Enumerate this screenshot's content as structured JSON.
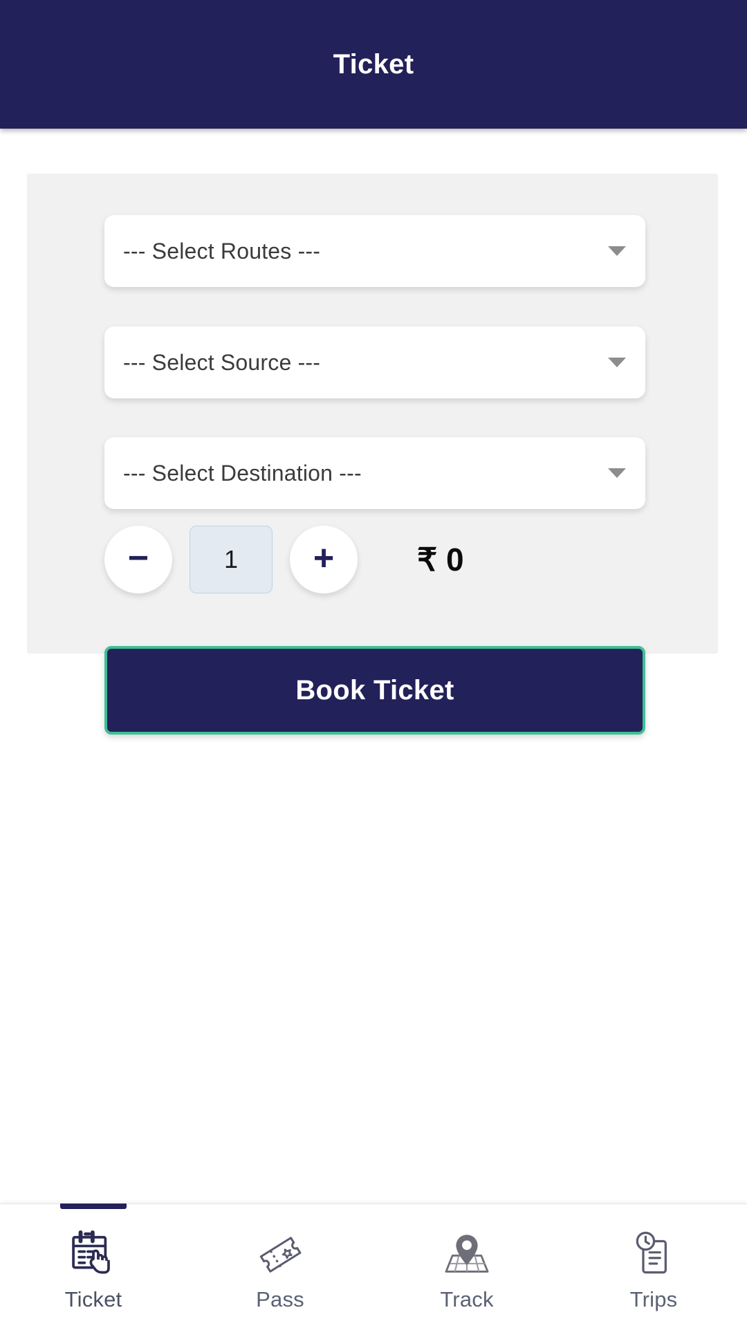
{
  "header": {
    "title": "Ticket",
    "background_color": "#232159",
    "text_color": "#ffffff"
  },
  "form": {
    "background_color": "#f1f1f2",
    "fields": [
      {
        "name": "routes",
        "value": "--- Select Routes ---",
        "icon": "chevron-down-icon"
      },
      {
        "name": "source",
        "value": "--- Select Source ---",
        "icon": "chevron-down-icon"
      },
      {
        "name": "destination",
        "value": "--- Select Destination ---",
        "icon": "chevron-down-icon"
      }
    ],
    "stepper": {
      "decrement_label": "−",
      "increment_label": "+",
      "quantity": "1",
      "accent_color": "#232159",
      "qty_box_color": "#e3eaf1"
    },
    "price": "₹ 0",
    "book_button": {
      "label": "Book Ticket",
      "background_color": "#232159",
      "border_color": "#3fbf95",
      "text_color": "#ffffff"
    }
  },
  "bottom_nav": {
    "active_index": 0,
    "items": [
      {
        "label": "Ticket",
        "icon": "calendar-tap-icon"
      },
      {
        "label": "Pass",
        "icon": "ticket-stub-icon"
      },
      {
        "label": "Track",
        "icon": "map-pin-icon"
      },
      {
        "label": "Trips",
        "icon": "clock-document-icon"
      }
    ]
  }
}
